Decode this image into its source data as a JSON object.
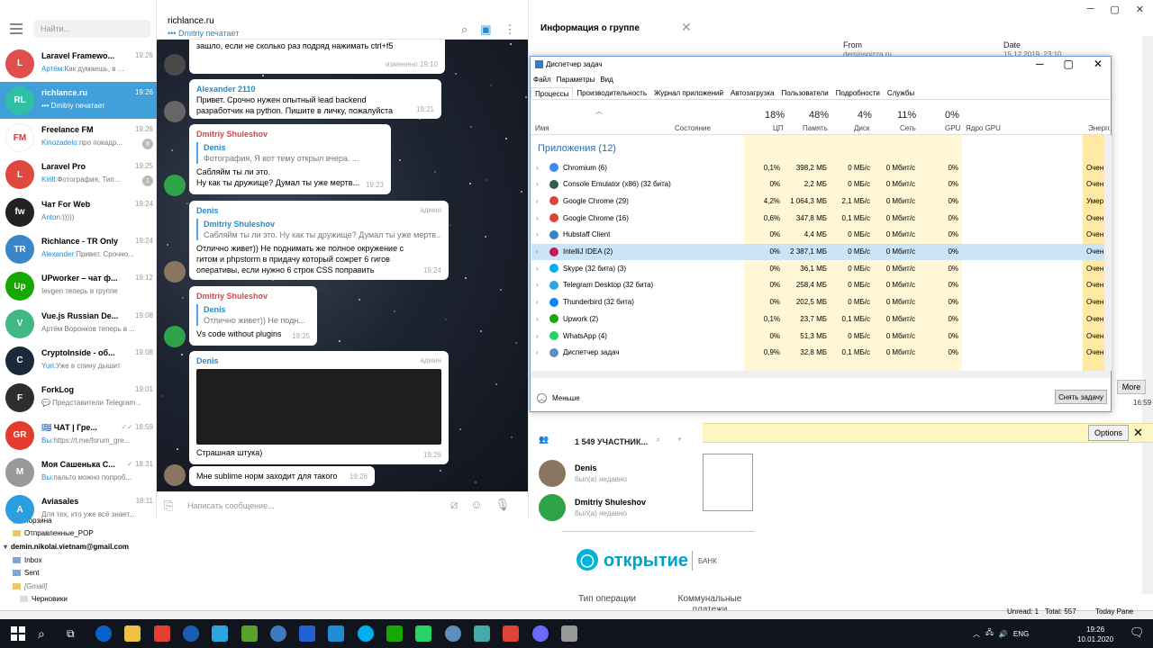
{
  "mail": {
    "columns": {
      "from": "From",
      "date": "Date"
    },
    "row1": {
      "from": "deminspizza.ru",
      "date": "15.12.2019, 23:10"
    },
    "options": "Options",
    "more": "More",
    "time": "16:59",
    "bank": {
      "name": "открытие",
      "sub": "БАНК",
      "op": "Тип операции",
      "comm": "Коммунальные платежи"
    },
    "status": {
      "unread": "Unread: 1",
      "total": "Total: 557",
      "today": "Today Pane"
    },
    "folders": [
      "Корзина",
      "Отправленные_POP",
      "demin.nikolai.vietnam@gmail.com",
      "Inbox",
      "Sent",
      "[Gmail]",
      "Черновики"
    ]
  },
  "telegram": {
    "search_placeholder": "Найти...",
    "chats": [
      {
        "name": "Laravel Framewo...",
        "time": "19:26",
        "sender": "Артём:",
        "text": "Как думаешь, в ...",
        "badge": "",
        "color": "#e04e4e",
        "initials": "L"
      },
      {
        "name": "richlance.ru",
        "time": "19:26",
        "sender": "",
        "text": "••• Dmitriy печатает",
        "badge": "",
        "color": "#2ebfa5",
        "initials": "RL"
      },
      {
        "name": "Freelance FM",
        "time": "19:26",
        "sender": "Kinozadelo:",
        "text": "про покадр...",
        "badge": "8",
        "color": "#ffffff",
        "initials": "FM"
      },
      {
        "name": "Laravel Pro",
        "time": "19:25",
        "sender": "Kirill:",
        "text": "Фотография, Тип...",
        "badge": "1",
        "color": "#e0473d",
        "initials": "L"
      },
      {
        "name": "Чат For Web",
        "time": "19:24",
        "sender": "Anton:",
        "text": ")))))",
        "badge": "",
        "color": "#222222",
        "initials": "fw"
      },
      {
        "name": "Richlance - TR Only",
        "time": "19:24",
        "sender": "Alexander:",
        "text": "Привет. Срочно...",
        "badge": "",
        "color": "#3a86c8",
        "initials": "TR"
      },
      {
        "name": "UPworker – чат ф...",
        "time": "19:12",
        "sender": "",
        "text": "Ievgen теперь в группе",
        "badge": "",
        "color": "#14a800",
        "initials": "Up"
      },
      {
        "name": "Vue.js Russian De...",
        "time": "19:08",
        "sender": "",
        "text": "Артём Воронков теперь в ...",
        "badge": "",
        "color": "#41b883",
        "initials": "V"
      },
      {
        "name": "CryptoInside - об...",
        "time": "19:08",
        "sender": "Yuri:",
        "text": "Уже в спину дышит",
        "badge": "",
        "color": "#1b2a3a",
        "initials": "C"
      },
      {
        "name": "ForkLog",
        "time": "19:01",
        "sender": "",
        "text": "💬 Представители Telegram ...",
        "badge": "",
        "color": "#2d2d2d",
        "initials": "F"
      },
      {
        "name": "🇬🇷 ЧАТ | Гре...",
        "time": "✓✓ 18:59",
        "sender": "Вы:",
        "text": "https://t.me/forum_gre...",
        "badge": "",
        "color": "#e23c2d",
        "initials": "GR"
      },
      {
        "name": "Моя Сашенька С...",
        "time": "✓ 18:31",
        "sender": "Вы:",
        "text": "пальто можно попроб...",
        "badge": "",
        "color": "#999999",
        "initials": "М"
      },
      {
        "name": "Aviasales",
        "time": "18:11",
        "sender": "",
        "text": "Для тех, кто уже всё знает...",
        "badge": "",
        "color": "#2a9ee0",
        "initials": "A"
      }
    ],
    "header": {
      "title": "richlance.ru",
      "status": "••• Dmitriy печатает"
    },
    "messages": [
      {
        "from": "",
        "text": "зашло, если не сколько раз подряд нажимать ctrl+f5",
        "time": "изменено 19:10"
      },
      {
        "from": "Alexander 2110",
        "text": "Привет. Срочно нужен опытный lead backend разработчик на python. Пишите в личку, пожалуйста",
        "time": "19:21"
      },
      {
        "from": "Dmitriy Shuleshov",
        "qname": "Denis",
        "qtext": "Фотография, Я вот тему открыл вчера. ...",
        "text": "Сабляйм ты ли это.\nНу как ты дружище? Думал ты уже мертв...",
        "time": "19:23"
      },
      {
        "from": "Denis",
        "admin": "админ",
        "qname": "Dmitriy Shuleshov",
        "qtext": "Сабляйм ты ли это. Ну как ты дружище? Думал ты уже мертв...",
        "text": "Отлично живет)) Не поднимать же полное окружение с гитом и phpstorm в придачу который сожрет 6 гигов оперативы, если нужно 6 строк CSS поправить",
        "time": "19:24"
      },
      {
        "from": "Dmitriy Shuleshov",
        "qname": "Denis",
        "qtext": "Отлично живет)) Не подн...",
        "text": "Vs code without plugins",
        "time": "19:25"
      },
      {
        "from": "Denis",
        "admin": "админ",
        "text": "Страшная штука)",
        "time": "19:26"
      },
      {
        "from": "",
        "text": "Мне sublime норм заходит для такого",
        "time": "19:26"
      }
    ],
    "input_placeholder": "Написать сообщение...",
    "info": {
      "title": "Информация о группе",
      "members": "1 549 УЧАСТНИК...",
      "member_list": [
        {
          "name": "Denis",
          "status": "был(а) недавно"
        },
        {
          "name": "Dmitriy Shuleshov",
          "status": "был(а) недавно"
        }
      ]
    }
  },
  "taskmgr": {
    "title": "Диспетчер задач",
    "menu": [
      "Файл",
      "Параметры",
      "Вид"
    ],
    "tabs": [
      "Процессы",
      "Производительность",
      "Журнал приложений",
      "Автозагрузка",
      "Пользователи",
      "Подробности",
      "Службы"
    ],
    "cols": {
      "name": "Имя",
      "state": "Состояние",
      "cpu": "ЦП",
      "mem": "Память",
      "disk": "Диск",
      "net": "Сеть",
      "gpu": "GPU",
      "gpucore": "Ядро GPU",
      "power": "Энерго"
    },
    "pct": {
      "cpu": "18%",
      "mem": "48%",
      "disk": "4%",
      "net": "11%",
      "gpu": "0%"
    },
    "group": "Приложения (12)",
    "rows": [
      {
        "name": "Chromium (6)",
        "cpu": "0,1%",
        "mem": "398,2 МБ",
        "disk": "0 МБ/с",
        "net": "0 Мбит/с",
        "gpu": "0%",
        "power": "Очен",
        "color": "#4285f4"
      },
      {
        "name": "Console Emulator (x86) (32 бита)",
        "cpu": "0%",
        "mem": "2,2 МБ",
        "disk": "0 МБ/с",
        "net": "0 Мбит/с",
        "gpu": "0%",
        "power": "Очен",
        "color": "#2e5e4e"
      },
      {
        "name": "Google Chrome (29)",
        "cpu": "4,2%",
        "mem": "1 064,3 МБ",
        "disk": "2,1 МБ/с",
        "net": "0 Мбит/с",
        "gpu": "0%",
        "power": "Умер",
        "color": "#db4437"
      },
      {
        "name": "Google Chrome (16)",
        "cpu": "0,6%",
        "mem": "347,8 МБ",
        "disk": "0,1 МБ/с",
        "net": "0 Мбит/с",
        "gpu": "0%",
        "power": "Очен",
        "color": "#db4437"
      },
      {
        "name": "Hubstaff Client",
        "cpu": "0%",
        "mem": "4,4 МБ",
        "disk": "0 МБ/с",
        "net": "0 Мбит/с",
        "gpu": "0%",
        "power": "Очен",
        "color": "#3b82c4"
      },
      {
        "name": "IntelliJ IDEA (2)",
        "cpu": "0%",
        "mem": "2 387,1 МБ",
        "disk": "0 МБ/с",
        "net": "0 Мбит/с",
        "gpu": "0%",
        "power": "Очен",
        "color": "#c2185b"
      },
      {
        "name": "Skype (32 бита) (3)",
        "cpu": "0%",
        "mem": "36,1 МБ",
        "disk": "0 МБ/с",
        "net": "0 Мбит/с",
        "gpu": "0%",
        "power": "Очен",
        "color": "#00aff0"
      },
      {
        "name": "Telegram Desktop (32 бита)",
        "cpu": "0%",
        "mem": "258,4 МБ",
        "disk": "0 МБ/с",
        "net": "0 Мбит/с",
        "gpu": "0%",
        "power": "Очен",
        "color": "#2ca5e0"
      },
      {
        "name": "Thunderbird (32 бита)",
        "cpu": "0%",
        "mem": "202,5 МБ",
        "disk": "0 МБ/с",
        "net": "0 Мбит/с",
        "gpu": "0%",
        "power": "Очен",
        "color": "#0a84ff"
      },
      {
        "name": "Upwork (2)",
        "cpu": "0,1%",
        "mem": "23,7 МБ",
        "disk": "0,1 МБ/с",
        "net": "0 Мбит/с",
        "gpu": "0%",
        "power": "Очен",
        "color": "#14a800"
      },
      {
        "name": "WhatsApp (4)",
        "cpu": "0%",
        "mem": "51,3 МБ",
        "disk": "0 МБ/с",
        "net": "0 Мбит/с",
        "gpu": "0%",
        "power": "Очен",
        "color": "#25d366"
      },
      {
        "name": "Диспетчер задач",
        "cpu": "0,9%",
        "mem": "32,8 МБ",
        "disk": "0,1 МБ/с",
        "net": "0 Мбит/с",
        "gpu": "0%",
        "power": "Очен",
        "color": "#5f8fbf"
      }
    ],
    "less": "Меньше",
    "endtask": "Снять задачу"
  },
  "taskbar": {
    "lang": "ENG",
    "time": "19:26",
    "date": "10.01.2020"
  }
}
